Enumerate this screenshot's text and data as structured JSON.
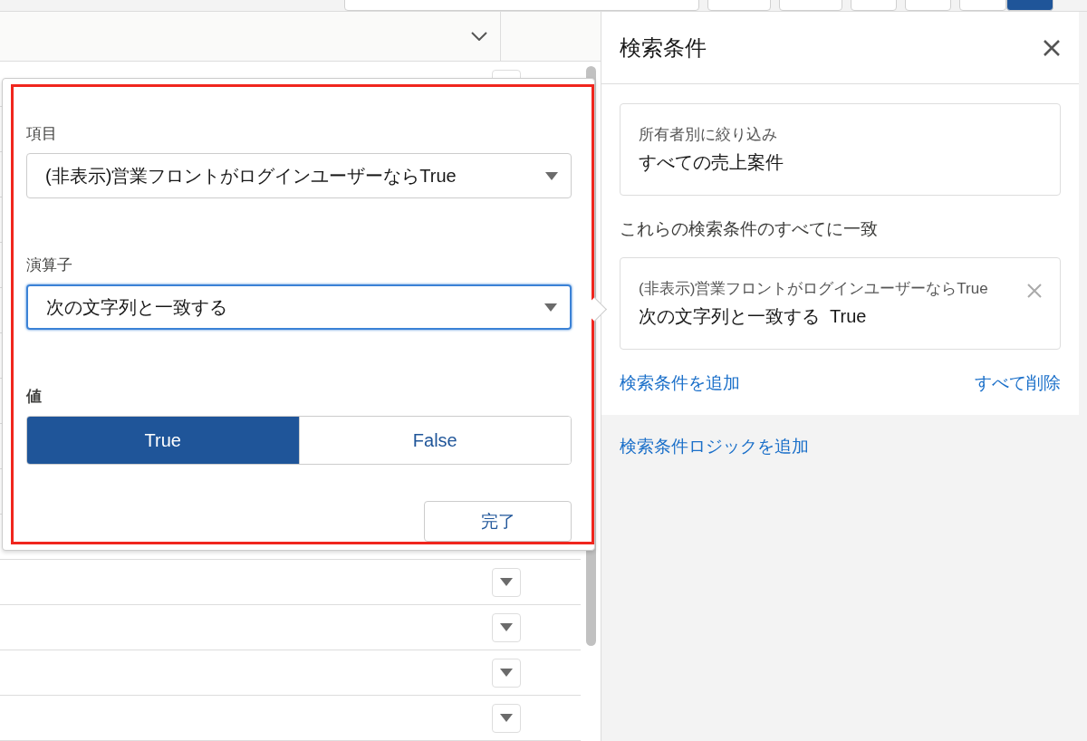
{
  "filter_popover": {
    "fields": [
      {
        "label": "項目",
        "kind": "select",
        "value": "(非表示)営業フロントがログインユーザーならTrue",
        "focused": false
      },
      {
        "label": "演算子",
        "kind": "select",
        "value": "次の文字列と一致する",
        "focused": true
      },
      {
        "label": "値",
        "kind": "toggle",
        "options": [
          {
            "label": "True",
            "selected": true
          },
          {
            "label": "False",
            "selected": false
          }
        ]
      }
    ],
    "done_button": "完了"
  },
  "filters_panel": {
    "title": "検索条件",
    "owner_filter": {
      "label": "所有者別に絞り込み",
      "value": "すべての売上案件"
    },
    "match_label": "これらの検索条件のすべてに一致",
    "conditions": [
      {
        "field": "(非表示)営業フロントがログインユーザーならTrue",
        "operator": "次の文字列と一致する",
        "value": "True"
      }
    ],
    "add_filter": "検索条件を追加",
    "remove_all": "すべて削除",
    "add_logic": "検索条件ロジックを追加"
  }
}
